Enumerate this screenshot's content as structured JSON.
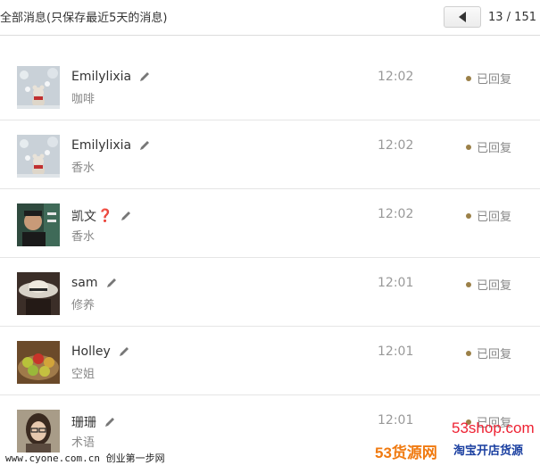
{
  "header": {
    "title": "全部消息(只保存最近5天的消息)",
    "page_counter": "13 / 151"
  },
  "messages": [
    {
      "name": "Emilylixia",
      "text": "咖啡",
      "time": "12:02",
      "status": "已回复",
      "avatar": "teddy-bear-snow"
    },
    {
      "name": "Emilylixia",
      "text": "香水",
      "time": "12:02",
      "status": "已回复",
      "avatar": "teddy-bear-snow"
    },
    {
      "name": "凯文",
      "name_suffix": "❓",
      "text": "香水",
      "time": "12:02",
      "status": "已回复",
      "avatar": "man-photo"
    },
    {
      "name": "sam",
      "text": "修养",
      "time": "12:01",
      "status": "已回复",
      "avatar": "hat-dark-photo"
    },
    {
      "name": "Holley",
      "text": "空姐",
      "time": "12:01",
      "status": "已回复",
      "avatar": "fruit-basket"
    },
    {
      "name": "珊珊",
      "text": "术语",
      "time": "12:01",
      "status": "已回复",
      "avatar": "woman-glasses"
    }
  ],
  "footer": {
    "site": "www.cyone.com.cn  创业第一步网"
  },
  "watermark": {
    "line1": "53shop.com",
    "line2": "53货源网",
    "line3": "淘宝开店货源"
  },
  "colors": {
    "status_dot": "#9b8048",
    "question_mark": "#d12a2a"
  }
}
